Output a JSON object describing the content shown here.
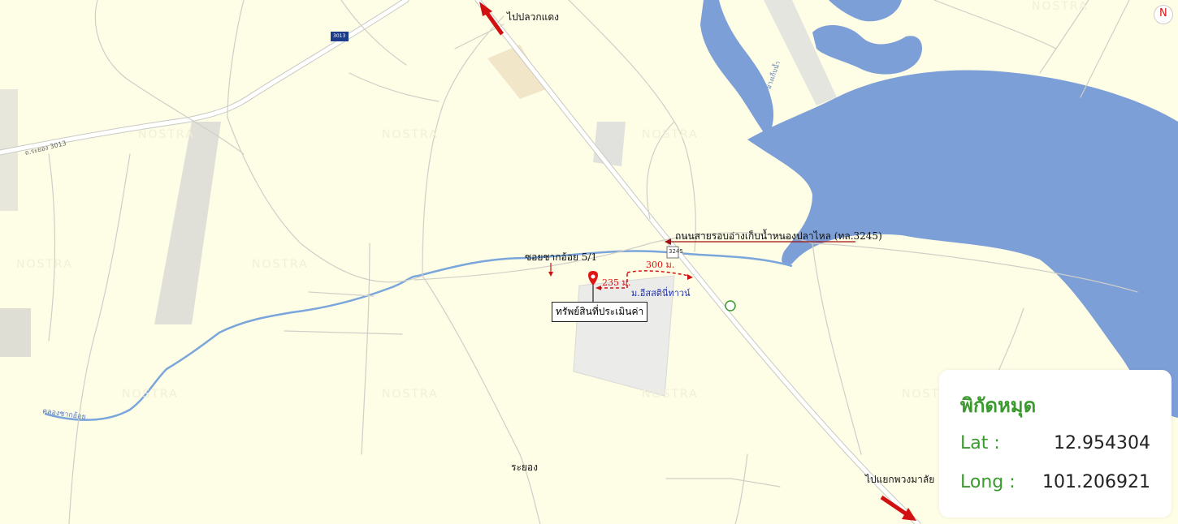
{
  "labels": {
    "to_pluak_daeng": "ไปปลวกแดง",
    "to_phuang_malai": "ไปแยกพวงมาลัย",
    "reservoir_road": "ถนนสายรอบอ่างเก็บน้ำหนองปลาไหล (ทล.3245)",
    "soi_chak_oi": "ซอยชากอ้อย 5/1",
    "property": "ทรัพย์สินที่ประเมินค่า",
    "dist_235": "235 ม.",
    "dist_300": "300 ม.",
    "village": "ม.อีสสตินี่ทาวน์",
    "rayong": "ระยอง",
    "canal": "คลองชากอ้อย",
    "road_3013": "ถ.ระยอง 3013",
    "route_3245": "3245",
    "route_shield": "3013",
    "water_label": "อ่างเก็บน้ำ"
  },
  "coordinates": {
    "title": "พิกัดหมุด",
    "lat_label": "Lat :",
    "lat_value": "12.954304",
    "long_label": "Long :",
    "long_value": "101.206921"
  },
  "compass": {
    "label": "N"
  },
  "colors": {
    "water": "#7d9fd7",
    "land": "#fefde6",
    "annotation": "#d11111",
    "stream": "#7aa6db"
  }
}
